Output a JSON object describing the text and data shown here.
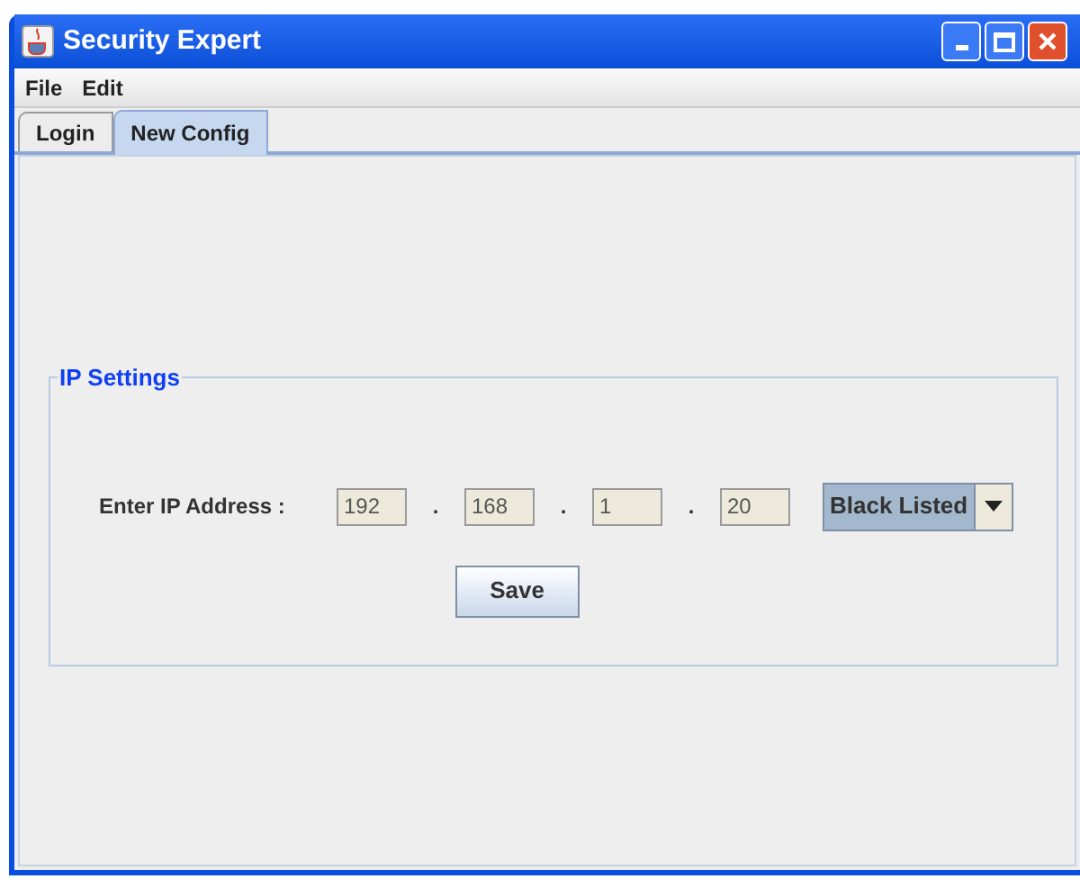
{
  "window": {
    "title": "Security Expert"
  },
  "menu": [
    "File",
    "Edit"
  ],
  "tabs": [
    {
      "label": "Login",
      "selected": false
    },
    {
      "label": "New Config",
      "selected": true
    }
  ],
  "ip_settings": {
    "title": "IP Settings",
    "label": "Enter IP Address :",
    "octets": [
      "192",
      "168",
      "1",
      "20"
    ],
    "separator": ".",
    "list_type": "Black Listed",
    "save": "Save"
  }
}
